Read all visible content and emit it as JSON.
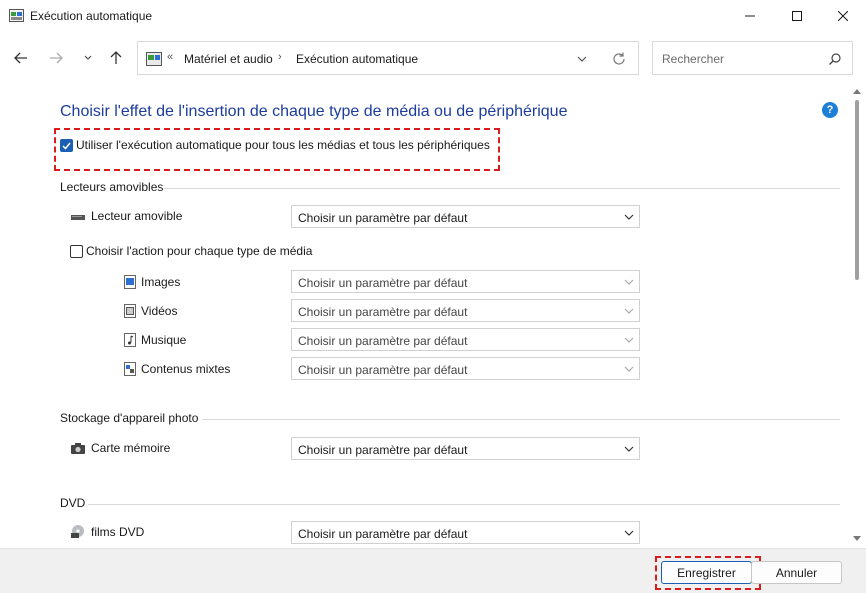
{
  "window": {
    "title": "Exécution automatique",
    "controls": {
      "minimize_icon": "minimize-icon",
      "maximize_icon": "maximize-icon",
      "close_icon": "close-icon"
    }
  },
  "nav": {
    "back_icon": "arrow-left-icon",
    "forward_icon": "arrow-right-icon",
    "recent_icon": "chevron-down-icon",
    "up_icon": "arrow-up-icon"
  },
  "address": {
    "prefix": "«",
    "segments": [
      "Matériel et audio",
      "Exécution automatique"
    ],
    "separator": "›"
  },
  "search": {
    "placeholder": "Rechercher"
  },
  "main": {
    "heading": "Choisir l'effet de l'insertion de chaque type de média ou de périphérique",
    "autoplay_all": {
      "label": "Utiliser l'exécution automatique pour tous les médias et tous les périphériques",
      "checked": true
    },
    "sections": {
      "removable": {
        "title": "Lecteurs amovibles",
        "removable_drive": {
          "label": "Lecteur amovible",
          "value": "Choisir un paramètre par défaut"
        },
        "choose_each": {
          "label": "Choisir l'action pour chaque type de média",
          "checked": false
        },
        "media": [
          {
            "label": "Images",
            "value": "Choisir un paramètre par défaut"
          },
          {
            "label": "Vidéos",
            "value": "Choisir un paramètre par défaut"
          },
          {
            "label": "Musique",
            "value": "Choisir un paramètre par défaut"
          },
          {
            "label": "Contenus mixtes",
            "value": "Choisir un paramètre par défaut"
          }
        ]
      },
      "camera": {
        "title": "Stockage d'appareil photo",
        "memory_card": {
          "label": "Carte mémoire",
          "value": "Choisir un paramètre par défaut"
        }
      },
      "dvd": {
        "title": "DVD",
        "dvd_movies": {
          "label": "films DVD",
          "value": "Choisir un paramètre par défaut"
        }
      }
    }
  },
  "footer": {
    "save": "Enregistrer",
    "cancel": "Annuler"
  },
  "colors": {
    "heading": "#1c3d9c",
    "accent": "#1a5fb4",
    "highlight": "#d91c1c"
  }
}
